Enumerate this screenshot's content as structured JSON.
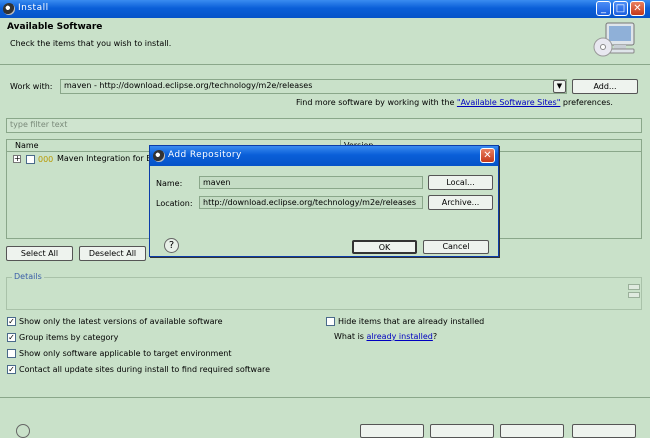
{
  "window": {
    "title": "Install",
    "min_label": "_",
    "max_label": "□",
    "close_label": "✕"
  },
  "header": {
    "title": "Available Software",
    "subtitle": "Check the items that you wish to install."
  },
  "work_with": {
    "label": "Work with:",
    "value": "maven - http://download.eclipse.org/technology/m2e/releases",
    "add_label": "Add...",
    "hint_prefix": "Find more software by working with the ",
    "hint_link": "\"Available Software Sites\"",
    "hint_suffix": " preferences."
  },
  "filter": {
    "placeholder": "type filter text"
  },
  "table": {
    "col_name": "Name",
    "col_version": "Version",
    "row_label": "Maven Integration for E"
  },
  "buttons": {
    "select_all": "Select All",
    "deselect_all": "Deselect All"
  },
  "details": {
    "label": "Details"
  },
  "options": {
    "latest_only": "Show only the latest versions of available software",
    "group_by_category": "Group items by category",
    "applicable_only": "Show only software applicable to target environment",
    "contact_sites": "Contact all update sites during install to find required software",
    "hide_installed": "Hide items that are already installed",
    "what_is_prefix": "What is ",
    "what_is_link": "already installed",
    "what_is_suffix": "?"
  },
  "dialog": {
    "title": "Add Repository",
    "name_label": "Name:",
    "name_value": "maven",
    "local_label": "Local...",
    "location_label": "Location:",
    "location_value": "http://download.eclipse.org/technology/m2e/releases",
    "archive_label": "Archive...",
    "ok_label": "OK",
    "cancel_label": "Cancel",
    "help_glyph": "?"
  },
  "colors": {
    "panel": "#c9e1c9",
    "title_bar": "#0a5fd8",
    "link": "#0000c0",
    "close_button": "#d3502a"
  }
}
